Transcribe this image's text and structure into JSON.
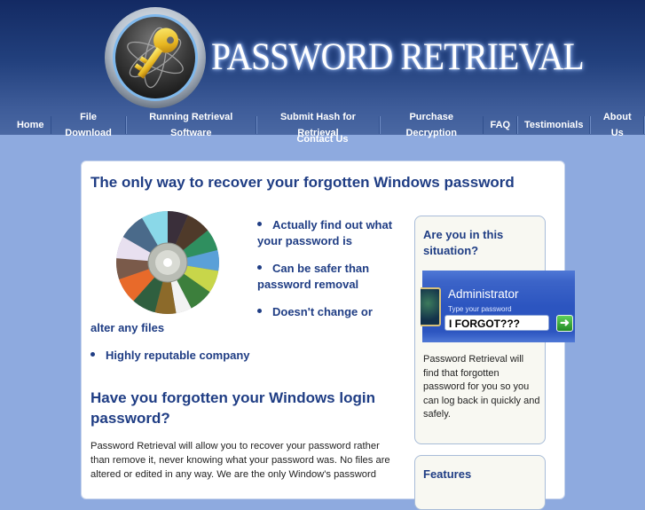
{
  "header": {
    "logo_text": "PASSWORD RETRIEVAL",
    "logo_icon": "key-atom-emblem-icon"
  },
  "nav": {
    "items": [
      {
        "label": "Home"
      },
      {
        "label": "File Download"
      },
      {
        "label": "Running Retrieval Software"
      },
      {
        "label": "Submit Hash for Retrieval"
      },
      {
        "label": "Purchase Decryption"
      },
      {
        "label": "FAQ"
      },
      {
        "label": "Testimonials"
      },
      {
        "label": "About Us"
      },
      {
        "label": "Contact Us"
      }
    ]
  },
  "main": {
    "title": "The only way to recover your forgotten Windows password",
    "image": "cd-disc-icon",
    "bullets": [
      {
        "line1": "Actually find out what",
        "line2": "your password is"
      },
      {
        "line1": "Can be safer than",
        "line2": "password removal"
      },
      {
        "line1": "Doesn't change or",
        "line2": "alter any files"
      },
      {
        "line1": "Highly reputable company"
      }
    ],
    "subheading": "Have you forgotten your Windows login password?",
    "body": "Password Retrieval will allow you to recover your password rather than remove it, never knowing what your password was.  No files are altered or edited in any way.  We are the only Window's password"
  },
  "sidebar": {
    "box1": {
      "title": "Are you in this situation?",
      "login": {
        "username": "Administrator",
        "hint": "Type your password",
        "password_value": "I FORGOT???",
        "go_icon": "arrow-right-icon"
      },
      "text": "Password Retrieval will find that forgotten password for you so you can log back in quickly and safely."
    },
    "box2": {
      "title": "Features"
    }
  },
  "colors": {
    "header_dark": "#132a63",
    "page_bg": "#8eaadf",
    "heading_blue": "#1f3d84",
    "sidebar_bg": "#f8f8f2"
  }
}
